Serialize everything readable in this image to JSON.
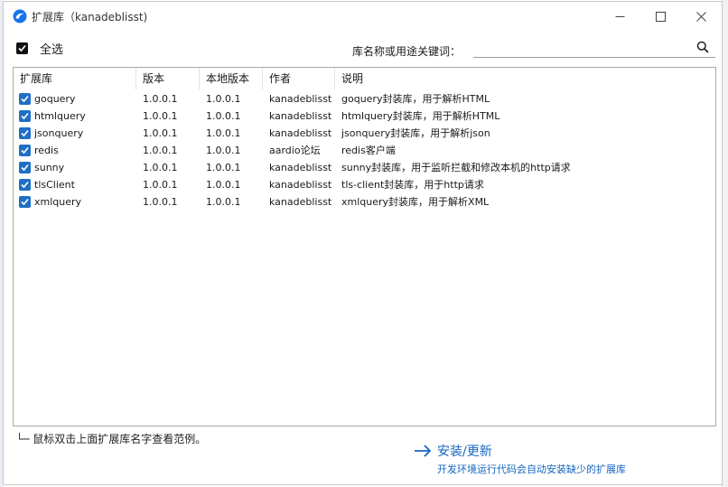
{
  "window": {
    "title": "扩展库（kanadeblisst)"
  },
  "toolbar": {
    "select_all_label": "全选",
    "search_label": "库名称或用途关键词：",
    "search_value": ""
  },
  "table": {
    "columns": [
      "扩展库",
      "版本",
      "本地版本",
      "作者",
      "说明"
    ],
    "rows": [
      {
        "checked": true,
        "name": "goquery",
        "version": "1.0.0.1",
        "local_version": "1.0.0.1",
        "author": "kanadeblisst",
        "desc": "goquery封装库，用于解析HTML"
      },
      {
        "checked": true,
        "name": "htmlquery",
        "version": "1.0.0.1",
        "local_version": "1.0.0.1",
        "author": "kanadeblisst",
        "desc": "htmlquery封装库，用于解析HTML"
      },
      {
        "checked": true,
        "name": "jsonquery",
        "version": "1.0.0.1",
        "local_version": "1.0.0.1",
        "author": "kanadeblisst",
        "desc": "jsonquery封装库，用于解析json"
      },
      {
        "checked": true,
        "name": "redis",
        "version": "1.0.0.1",
        "local_version": "1.0.0.1",
        "author": "aardio论坛",
        "desc": "redis客户端"
      },
      {
        "checked": true,
        "name": "sunny",
        "version": "1.0.0.1",
        "local_version": "1.0.0.1",
        "author": "kanadeblisst",
        "desc": "sunny封装库，用于监听拦截和修改本机的http请求"
      },
      {
        "checked": true,
        "name": "tlsClient",
        "version": "1.0.0.1",
        "local_version": "1.0.0.1",
        "author": "kanadeblisst",
        "desc": "tls-client封装库，用于http请求"
      },
      {
        "checked": true,
        "name": "xmlquery",
        "version": "1.0.0.1",
        "local_version": "1.0.0.1",
        "author": "kanadeblisst",
        "desc": "xmlquery封装库，用于解析XML"
      }
    ]
  },
  "footer": {
    "hint": "└─ 鼠标双击上面扩展库名字查看范例。",
    "install_label": "安装/更新",
    "install_desc": "开发环境运行代码会自动安装缺少的扩展库"
  },
  "colors": {
    "accent": "#1565c0",
    "checkbox": "#1f6fc5"
  },
  "icons": [
    "app-icon",
    "minimize-icon",
    "maximize-icon",
    "close-icon",
    "search-icon",
    "check-icon",
    "arrow-right-icon"
  ]
}
